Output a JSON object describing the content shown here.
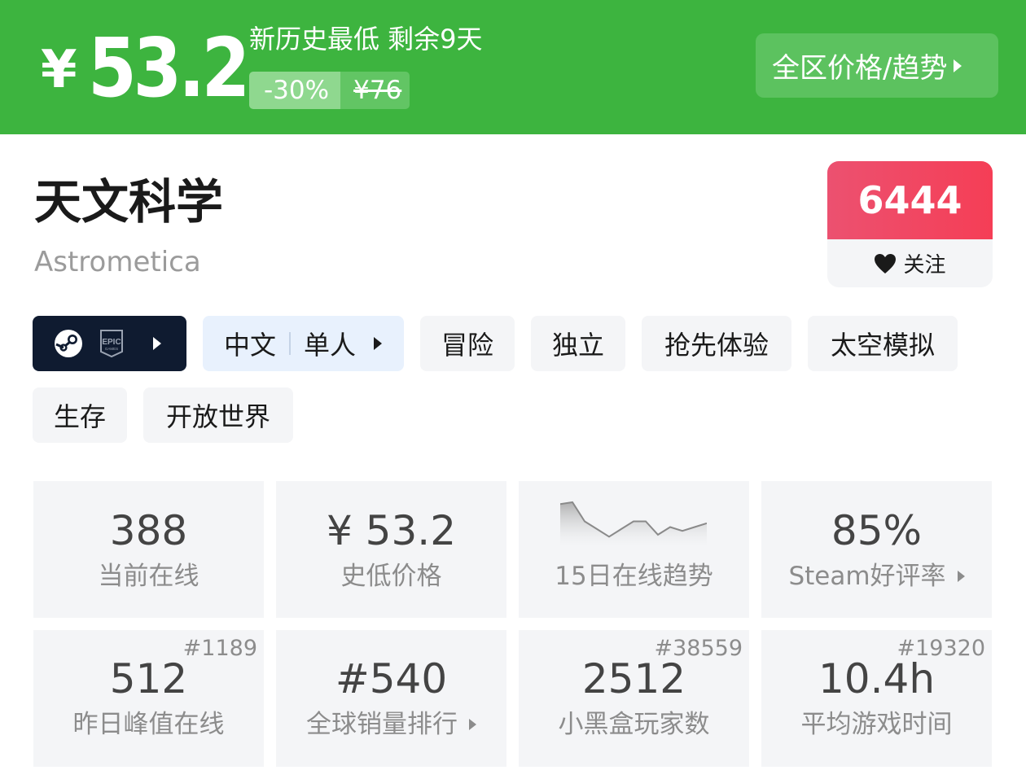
{
  "banner": {
    "currency": "¥",
    "price": "53.2",
    "note": "新历史最低 剩余9天",
    "discount": "-30%",
    "original_price": "¥76",
    "region_button": "全区价格/趋势"
  },
  "game": {
    "title": "天文科学",
    "subtitle": "Astrometica"
  },
  "follow": {
    "count": "6444",
    "label": "关注"
  },
  "tags": {
    "platform": {
      "steam": "steam-logo-icon",
      "epic": "epic-games-logo-icon"
    },
    "language": "中文",
    "mode": "单人",
    "genres": [
      "冒险",
      "独立",
      "抢先体验",
      "太空模拟",
      "生存",
      "开放世界"
    ]
  },
  "stats": [
    {
      "value": "388",
      "label": "当前在线",
      "rank": ""
    },
    {
      "value": "¥ 53.2",
      "label": "史低价格",
      "rank": ""
    },
    {
      "value": "",
      "label": "15日在线趋势",
      "rank": ""
    },
    {
      "value": "85%",
      "label": "Steam好评率",
      "rank": ""
    },
    {
      "value": "512",
      "label": "昨日峰值在线",
      "rank": "#1189"
    },
    {
      "value": "#540",
      "label": "全球销量排行",
      "rank": ""
    },
    {
      "value": "2512",
      "label": "小黑盒玩家数",
      "rank": "#38559"
    },
    {
      "value": "10.4h",
      "label": "平均游戏时间",
      "rank": "#19320"
    }
  ],
  "trend_chart": {
    "type": "area",
    "values": [
      22,
      23,
      13,
      9,
      5,
      9,
      13,
      13,
      6,
      10,
      8,
      10,
      12
    ]
  },
  "colors": {
    "banner_green": "#3db43f",
    "follow_red": "#f53e56",
    "platform_dark": "#0f1b30",
    "language_blue": "#e8f1fd"
  }
}
